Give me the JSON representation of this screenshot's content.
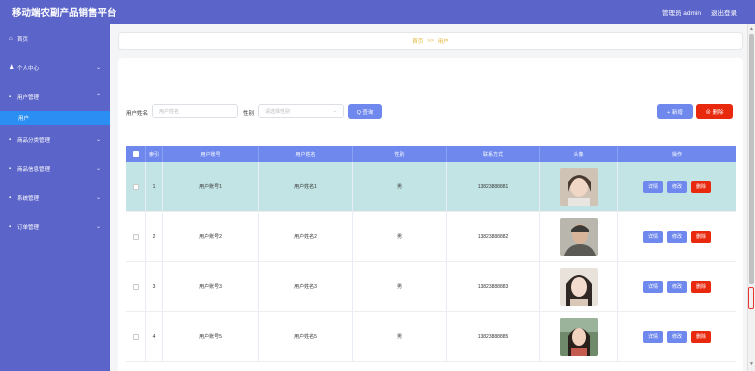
{
  "app": {
    "title": "移动端农副产品销售平台"
  },
  "topbar": {
    "user": "管理员 admin",
    "logout": "退出登录"
  },
  "sidebar": {
    "items": [
      {
        "icon": "home-icon",
        "glyph": "⌂",
        "label": "首页",
        "chevron": false
      },
      {
        "icon": "user-icon",
        "glyph": "♟",
        "label": "个人中心",
        "chevron": true
      },
      {
        "icon": "grid-icon",
        "glyph": "▪",
        "label": "用户管理",
        "chevron": true
      },
      {
        "icon": "category-icon",
        "glyph": "▪",
        "label": "商品分类管理",
        "chevron": true
      },
      {
        "icon": "product-icon",
        "glyph": "▪",
        "label": "商品信息管理",
        "chevron": true
      },
      {
        "icon": "settings-icon",
        "glyph": "▪",
        "label": "系统管理",
        "chevron": true
      },
      {
        "icon": "order-icon",
        "glyph": "▪",
        "label": "订单管理",
        "chevron": true
      }
    ],
    "active_sub": "用户"
  },
  "breadcrumb": {
    "home": "首页",
    "sep": ">>",
    "current": "用户"
  },
  "search": {
    "name_label": "用户姓名",
    "name_placeholder": "用户姓名",
    "gender_label": "性别",
    "gender_placeholder": "请选择性别",
    "query_button": "Q 查询",
    "add_button": "+ 新增",
    "delete_button": "⊗ 删除"
  },
  "table": {
    "columns": [
      "",
      "索引",
      "用户账号",
      "用户姓名",
      "性别",
      "联系方式",
      "头像",
      "操作"
    ],
    "rows": [
      {
        "index": "1",
        "account": "用户账号1",
        "name": "用户姓名1",
        "gender": "男",
        "phone": "13823888881"
      },
      {
        "index": "2",
        "account": "用户账号2",
        "name": "用户姓名2",
        "gender": "男",
        "phone": "13823888882"
      },
      {
        "index": "3",
        "account": "用户账号3",
        "name": "用户姓名3",
        "gender": "男",
        "phone": "13823888883"
      },
      {
        "index": "4",
        "account": "用户账号5",
        "name": "用户姓名5",
        "gender": "男",
        "phone": "13823888885"
      }
    ],
    "actions": {
      "detail": "详情",
      "edit": "修改",
      "delete": "删除"
    }
  },
  "colors": {
    "primary": "#5b64c9",
    "accent_blue": "#6e88ee",
    "danger": "#e8290e",
    "highlight_row": "#c3e4e4",
    "sub_active": "#2b8ef3"
  }
}
